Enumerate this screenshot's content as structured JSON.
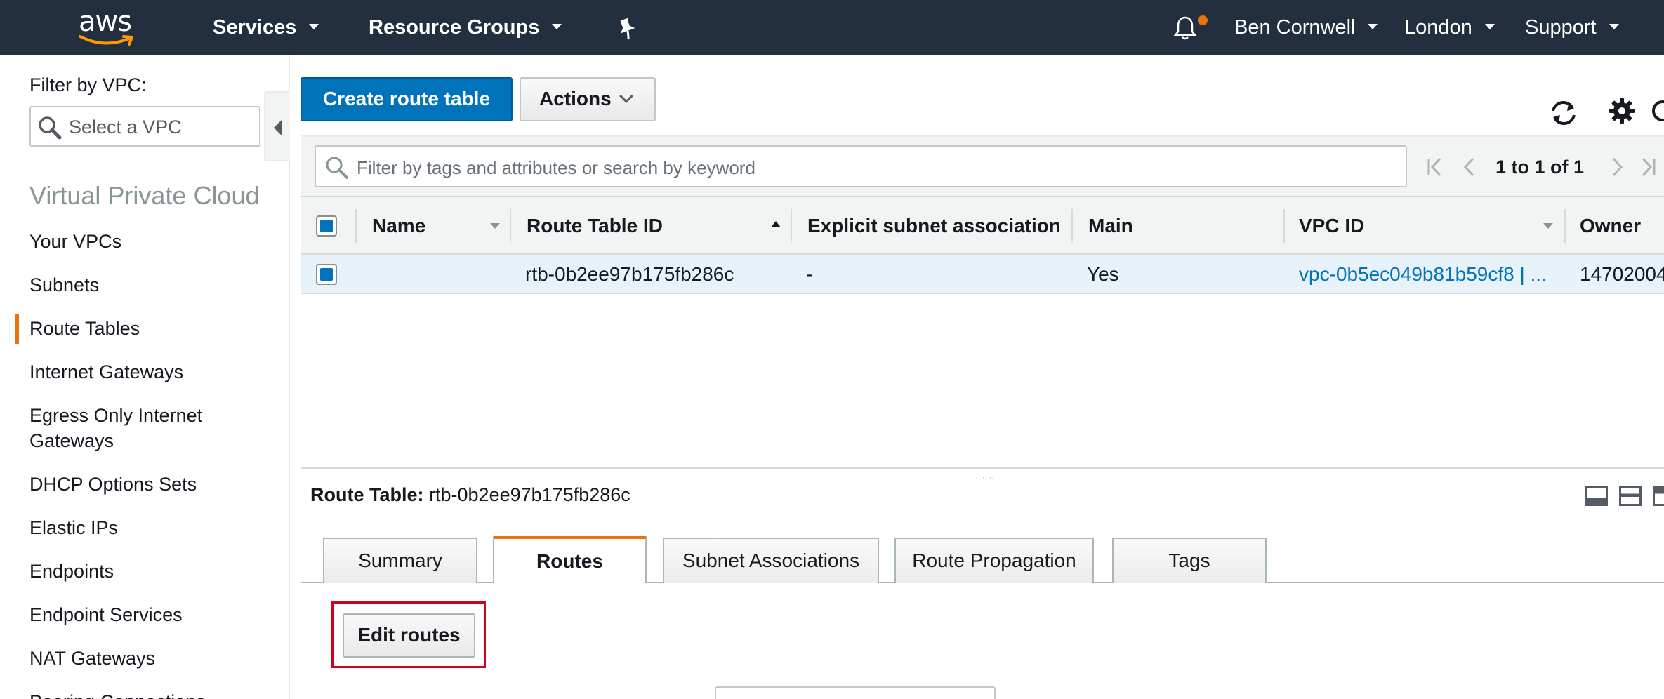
{
  "topnav": {
    "logo_text": "aws",
    "services": "Services",
    "resource_groups": "Resource Groups",
    "user": "Ben Cornwell",
    "region": "London",
    "support": "Support"
  },
  "sidebar": {
    "filter_label": "Filter by VPC:",
    "vpc_placeholder": "Select a VPC",
    "section_title": "Virtual Private Cloud",
    "items": [
      {
        "label": "Your VPCs"
      },
      {
        "label": "Subnets"
      },
      {
        "label": "Route Tables",
        "active": true
      },
      {
        "label": "Internet Gateways"
      },
      {
        "label": "Egress Only Internet Gateways"
      },
      {
        "label": "DHCP Options Sets"
      },
      {
        "label": "Elastic IPs"
      },
      {
        "label": "Endpoints"
      },
      {
        "label": "Endpoint Services"
      },
      {
        "label": "NAT Gateways"
      },
      {
        "label": "Peering Connections"
      }
    ]
  },
  "toolbar": {
    "create_label": "Create route table",
    "actions_label": "Actions"
  },
  "search": {
    "placeholder": "Filter by tags and attributes or search by keyword",
    "pagination": "1 to 1 of 1"
  },
  "table": {
    "columns": [
      "Name",
      "Route Table ID",
      "Explicit subnet association",
      "Main",
      "VPC ID",
      "Owner"
    ],
    "rows": [
      {
        "name": "",
        "route_table_id": "rtb-0b2ee97b175fb286c",
        "explicit_subnet_association": "-",
        "main": "Yes",
        "vpc_id": "vpc-0b5ec049b81b59cf8 | ...",
        "owner": "14702004"
      }
    ]
  },
  "details": {
    "label": "Route Table:",
    "value": "rtb-0b2ee97b175fb286c",
    "tabs": [
      "Summary",
      "Routes",
      "Subnet Associations",
      "Route Propagation",
      "Tags"
    ],
    "active_tab": "Routes",
    "edit_label": "Edit routes"
  },
  "colors": {
    "nav_bg": "#232f3e",
    "primary": "#0073bb",
    "accent": "#ec7211",
    "highlight": "#d0021b"
  },
  "icons": [
    "aws-logo",
    "pin-icon",
    "bell-icon",
    "search-icon",
    "refresh-icon",
    "gear-icon",
    "first-page-icon",
    "prev-page-icon",
    "next-page-icon",
    "last-page-icon"
  ]
}
